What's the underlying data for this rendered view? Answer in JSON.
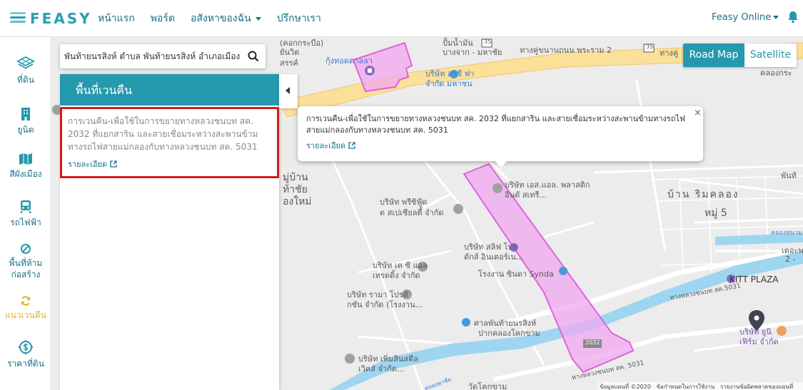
{
  "brand": {
    "logo_text": "FEASY"
  },
  "nav": {
    "items": [
      "หน้าแรก",
      "พอร์ต",
      "อสังหาของฉัน",
      "ปรึกษาเรา"
    ],
    "account_label": "Feasy Online"
  },
  "sidebar": {
    "items": [
      {
        "label": "ที่ดิน",
        "icon": "layers-icon"
      },
      {
        "label": "ยูนิต",
        "icon": "building-icon"
      },
      {
        "label": "สีผังเมือง",
        "icon": "map-icon"
      },
      {
        "label": "รถไฟฟ้า",
        "icon": "train-icon"
      },
      {
        "label": "พื้นที่ห้ามก่อสร้าง",
        "icon": "ban-icon"
      },
      {
        "label": "แนวเวนคืน",
        "icon": "refresh-icon",
        "active": true
      },
      {
        "label": "ราคาที่ดิน",
        "icon": "price-icon"
      }
    ],
    "active_color": "#e0b41c"
  },
  "search": {
    "value": "พันท้ายนรสิงห์ ตำบล พันท้ายนรสิงห์ อำเภอเมือง"
  },
  "panel": {
    "title": "พื้นที่เวนคืน",
    "card_text": "การเวนคืน-เพื่อใช้ในการขยายทางหลวงชนบท สค. 2032 ที่แยกสาริน และสายเชื่อมระหว่างสะพานข้ามทางรถไฟสายแม่กลองกับทางหลวงชนบท สค. 5031",
    "detail_label": "รายละเอียด"
  },
  "popup": {
    "text": "การเวนคืน-เพื่อใช้ในการขยายทางหลวงชนบท สค. 2032 ที่แยกสาริน และสายเชื่อมระหว่างสะพานข้ามทางรถไฟสายแม่กลองกับทางหลวงชนบท สค. 5031",
    "detail_label": "รายละเอียด",
    "close_label": "×"
  },
  "map_type": {
    "road_label": "Road Map",
    "satellite_label": "Satellite",
    "selected": "Road Map"
  },
  "map_labels": {
    "l1": "ปั้มน้ำมัน",
    "l2": "บางจาก - มหาชัย",
    "l3": "ทางคู่ขนานถนน พระราม 2",
    "l4": "35",
    "l5": "35",
    "l6": "ทางคู่",
    "l7": "กุ้งทอดตาลลา",
    "l8": "บริษัท อาซี ฟา จำกัด มหาชน",
    "l9": "(คอกกระบือ)",
    "l10": "ยันวิต",
    "l11": "สรรค์",
    "l12": "คลองกระ",
    "l13": "บริษัท เอส.แอล. พลาสติกอินดั สเทรี...",
    "l14": "บ้าน ริมคลอง",
    "l15": "หมู่ 5",
    "l16": "มู่บ้าน",
    "l17": "ท้าชัย",
    "l18": "องใหม่",
    "l19": "บริษัท พรีซิฟู้ด",
    "l20": "ด สเปเชียลตี้ จำกัด",
    "l21": "บริษัท สลิฟ โปร",
    "l22": "ดักส์ อินเตอร์เน...",
    "l23": "บริษัท เค ซี แอล",
    "l24": "เทรดดิ้ง จำกัด",
    "l25": "โรงงาน ซินดา Synda",
    "l26": "บริษัท รามา โปรดั",
    "l27": "กชัน จำกัด (โรงงาน...",
    "l28": "ศาลพันท้ายนรสิงห์",
    "l29": "ปากคลองโคกขาม",
    "l30": "บริษัท เพิ่มสินสตีล",
    "l31": "เวิคส์ จำกัด...",
    "l32": "วัดโคกขาม",
    "l33": "ทางหลวงชนบท สค.5031",
    "l34": "ทางหลวงชนบท สค. 5031",
    "l35": "2032",
    "l36": "KITT PLAZA",
    "l37": "บริษัท ยูนิ",
    "l38": "เฟิร์ม จำกัด",
    "l39": "พันท้",
    "l40": "เดอะพ",
    "l41": "2 -",
    "l42": "คลองสนามชัย",
    "l43": "คลองพาชัย"
  },
  "attribution": {
    "data": "ข้อมูลแผนที่ ©2020",
    "terms": "ข้อกำหนดในการใช้งาน",
    "report": "รายงานข้อผิดพลาดของแผนที่"
  },
  "colors": {
    "brand_teal": "#2599ad",
    "nav_text": "#1b6f8a",
    "highlight_red": "#d11c1c",
    "expropriation_fill": "#f0a8f0",
    "expropriation_stroke": "#e060e0",
    "river": "#9ed5f0",
    "major_road": "#fbe09a"
  }
}
